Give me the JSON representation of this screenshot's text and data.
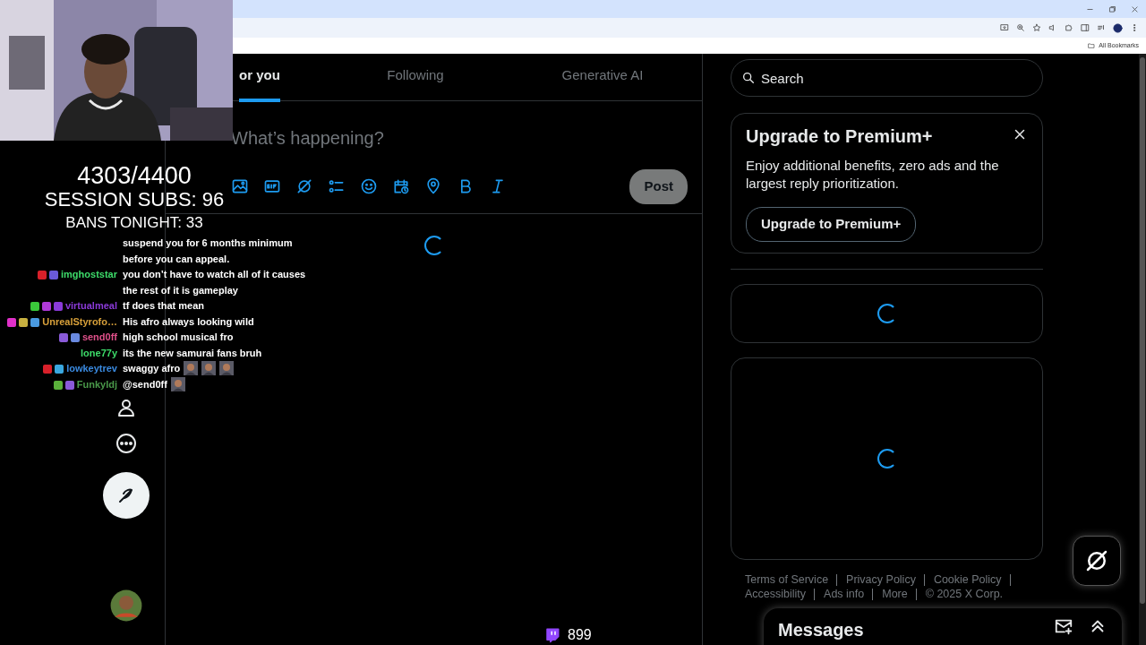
{
  "browser": {
    "bookmarks_label": "All Bookmarks"
  },
  "stream_overlay": {
    "stats": [
      "4303/4400",
      "SESSION SUBS: 96",
      "BANS TONIGHT: 33"
    ],
    "chat": [
      {
        "text": "suspend you for 6 months minimum before you can appeal."
      },
      {
        "user": "imghoststar",
        "color": "#3ddc6a",
        "badges": [
          {
            "color": "#d8202a"
          },
          {
            "color": "#6a5ad8"
          }
        ],
        "text": "you don’t have to watch all of it causes the rest of it is gameplay"
      },
      {
        "user": "virtualmeal",
        "color": "#8a3ad8",
        "badges": [
          {
            "color": "#3ac83a"
          },
          {
            "color": "#b03ad8"
          },
          {
            "color": "#8a3ad8"
          }
        ],
        "text": "tf does that mean"
      },
      {
        "user": "UnrealStyrofo…",
        "color": "#d8a03a",
        "badges": [
          {
            "color": "#e030c8"
          },
          {
            "color": "#c8b040"
          },
          {
            "color": "#4a9ae0"
          }
        ],
        "text": "His afro always looking wild"
      },
      {
        "user": "send0ff",
        "color": "#e0508a",
        "badges": [
          {
            "color": "#8a5ad8"
          },
          {
            "color": "#6a8ae0"
          }
        ],
        "text": "high school musical fro"
      },
      {
        "user": "lone77y",
        "color": "#3ddc6a",
        "text": "its the new samurai fans bruh"
      },
      {
        "user": "lowkeytrev",
        "color": "#3a8ae0",
        "badges": [
          {
            "color": "#d8202a"
          },
          {
            "color": "#3aa8e0"
          }
        ],
        "text": "swaggy afro",
        "emotes": [
          {
            "kind": "picture"
          },
          {
            "kind": "picture"
          },
          {
            "kind": "picture"
          }
        ]
      },
      {
        "user": "Funkyldj",
        "color": "#4a9a4a",
        "badges": [
          {
            "color": "#5ab03a"
          },
          {
            "color": "#8a5ad8"
          }
        ],
        "text": "@send0ff",
        "emotes": [
          {
            "kind": "picture"
          }
        ]
      }
    ],
    "viewer_count": "899"
  },
  "tabs": [
    {
      "label": "or you",
      "selected": true
    },
    {
      "label": "Following",
      "selected": false
    },
    {
      "label": "Generative AI",
      "selected": false
    }
  ],
  "composer": {
    "placeholder": "What’s happening?",
    "post_button": "Post"
  },
  "search": {
    "placeholder": "Search"
  },
  "premium": {
    "title": "Upgrade to Premium+",
    "text": "Enjoy additional benefits, zero ads and the largest reply prioritization.",
    "button": "Upgrade to Premium+"
  },
  "footer_links": [
    "Terms of Service",
    "Privacy Policy",
    "Cookie Policy",
    "Accessibility",
    "Ads info",
    "More",
    "© 2025 X Corp."
  ],
  "messages": {
    "title": "Messages"
  }
}
